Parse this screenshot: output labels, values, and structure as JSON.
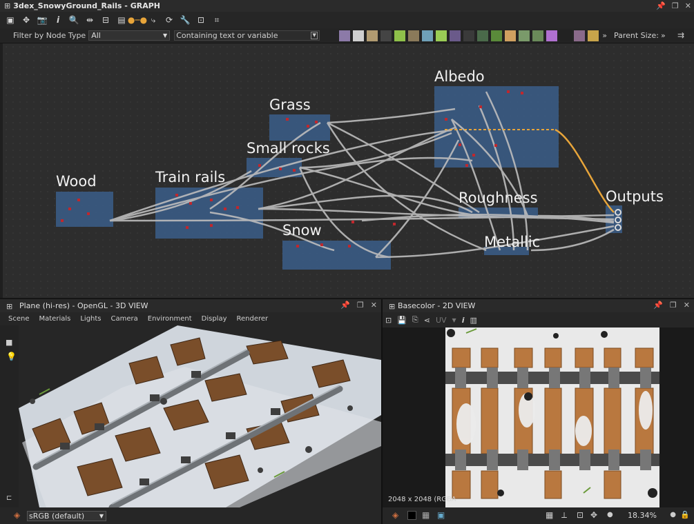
{
  "window": {
    "title": "3dex_SnowyGround_Rails - GRAPH"
  },
  "filter": {
    "label": "Filter by Node Type",
    "type_value": "All",
    "text_placeholder": "Containing text or variable",
    "parent_size_label": "Parent Size:"
  },
  "graph": {
    "frames": [
      {
        "name": "Wood"
      },
      {
        "name": "Train rails"
      },
      {
        "name": "Grass"
      },
      {
        "name": "Small rocks"
      },
      {
        "name": "Snow"
      },
      {
        "name": "Albedo"
      },
      {
        "name": "Roughness"
      },
      {
        "name": "Metallic"
      },
      {
        "name": "Outputs"
      }
    ]
  },
  "view3d": {
    "title": "Plane (hi-res) - OpenGL - 3D VIEW",
    "menu": [
      "Scene",
      "Materials",
      "Lights",
      "Camera",
      "Environment",
      "Display",
      "Renderer"
    ],
    "color_space": "sRGB (default)"
  },
  "view2d": {
    "title": "Basecolor - 2D VIEW",
    "uv_label": "UV",
    "resolution": "2048 x 2048 (RGBA",
    "zoom": "18.34%"
  },
  "colors": {
    "frame": "#3a5a82",
    "wire": "#bdbdbd",
    "active_wire": "#e8a53a",
    "snow": "#e6e6e6",
    "wood": "#b9783f"
  }
}
